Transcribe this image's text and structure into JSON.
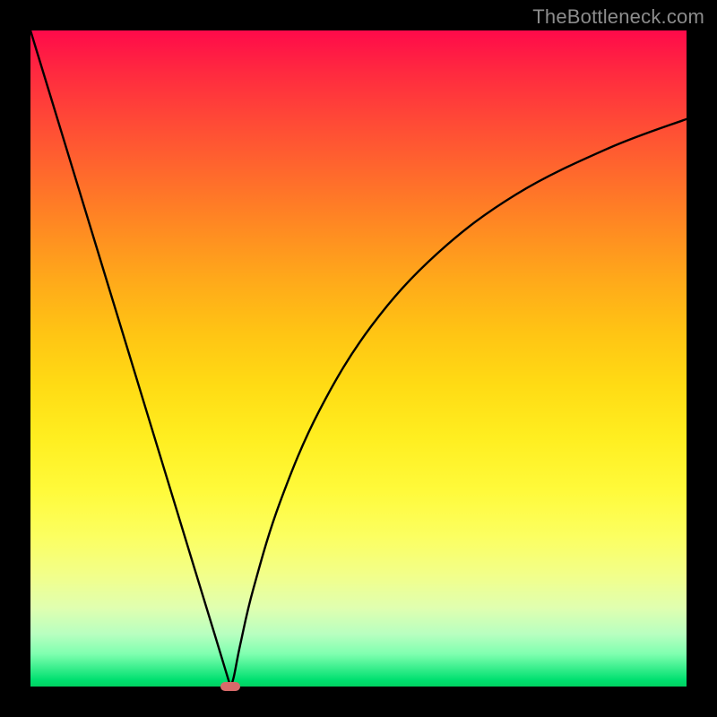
{
  "watermark": "TheBottleneck.com",
  "chart_data": {
    "type": "line",
    "title": "",
    "xlabel": "",
    "ylabel": "",
    "xlim": [
      0,
      100
    ],
    "ylim": [
      0,
      100
    ],
    "grid": false,
    "series": [
      {
        "name": "curve",
        "x": [
          0,
          5,
          10,
          15,
          20,
          25,
          28,
          30,
          30.5,
          31,
          32,
          34,
          38,
          44,
          52,
          62,
          74,
          88,
          100
        ],
        "y": [
          100,
          83.6,
          67.2,
          50.8,
          34.4,
          18,
          8.2,
          1.6,
          0,
          1.5,
          6.5,
          15,
          28,
          42,
          55,
          66,
          75,
          82,
          86.5
        ]
      }
    ],
    "marker": {
      "x": 30.5,
      "y": 0
    },
    "colors": {
      "curve": "#000000",
      "marker": "#d86a6a",
      "gradient_top": "#ff0a4a",
      "gradient_bottom": "#00d060"
    }
  }
}
